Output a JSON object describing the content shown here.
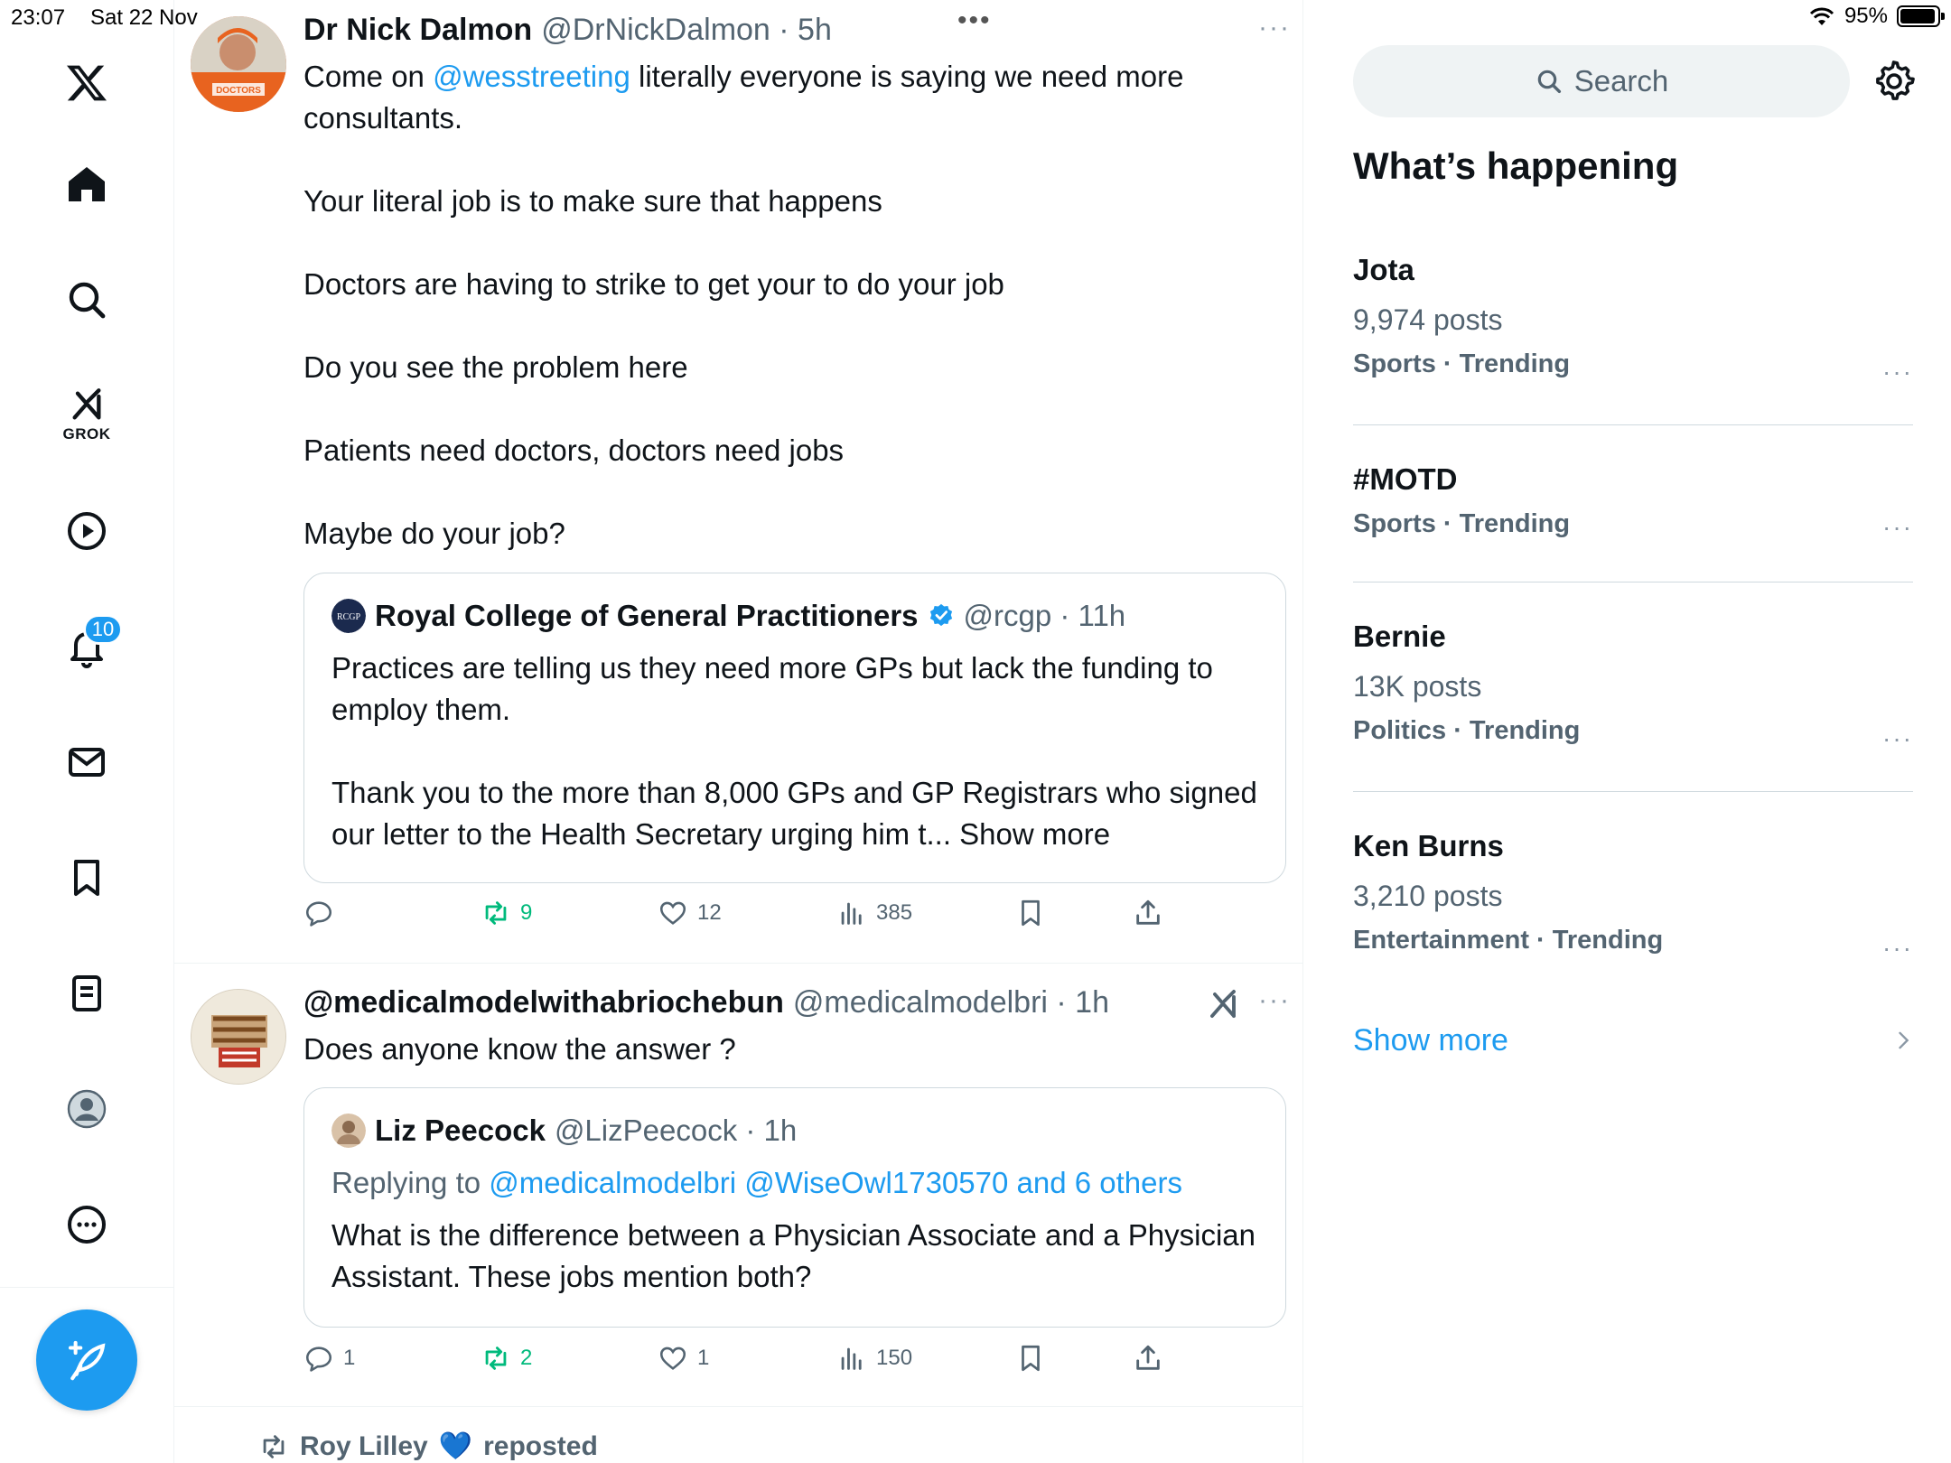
{
  "status": {
    "time": "23:07",
    "date": "Sat 22 Nov",
    "battery": "95%",
    "battery_level": 0.95
  },
  "nav": {
    "grok_label": "GROK",
    "notifications_count": "10"
  },
  "posts": [
    {
      "author": "Dr Nick Dalmon",
      "meta": "@DrNickDalmon · 5h",
      "text_prefix": "Come on ",
      "mention": "@wesstreeting",
      "text_suffix": " literally everyone is saying we need more consultants.\n\nYour literal job is to make sure that happens\n\nDoctors are having to strike to get your to do your job\n\nDo you see the problem here\n\nPatients need doctors, doctors need jobs\n\nMaybe do your job?",
      "avatar_text": "DOCTORS",
      "quote": {
        "author": "Royal College of General Practitioners",
        "avatar_text": "RCGP",
        "meta": "@rcgp · 11h",
        "text": "Practices are telling us they need more GPs but lack the funding to employ them.\n\nThank you to the more than 8,000 GPs and GP Registrars who signed our letter to the Health Secretary urging him t... Show more"
      },
      "actions": {
        "replies": "",
        "reposts": "9",
        "likes": "12",
        "views": "385"
      }
    },
    {
      "author": "@medicalmodelwithabriochebun",
      "meta": "@medicalmodelbri · 1h",
      "text": "Does anyone know the answer ?",
      "quote": {
        "author": "Liz Peecock",
        "meta": "@LizPeecock · 1h",
        "replying_to_label": "Replying to ",
        "replying_to": "@medicalmodelbri @WiseOwl1730570 and 6 others",
        "text": "What is the difference between a Physician Associate and a Physician Assistant.  These jobs mention both?"
      },
      "actions": {
        "replies": "1",
        "reposts": "2",
        "likes": "1",
        "views": "150"
      }
    }
  ],
  "reposted": {
    "name": "Roy Lilley",
    "emoji": "💙",
    "label": "reposted"
  },
  "right": {
    "search_placeholder": "Search",
    "whats_happening": "What’s happening",
    "trends": [
      {
        "title": "Jota",
        "posts": "9,974 posts",
        "category": "Sports · Trending"
      },
      {
        "title": "#MOTD",
        "posts": "",
        "category": "Sports · Trending"
      },
      {
        "title": "Bernie",
        "posts": "13K posts",
        "category": "Politics · Trending"
      },
      {
        "title": "Ken Burns",
        "posts": "3,210 posts",
        "category": "Entertainment · Trending"
      }
    ],
    "show_more": "Show more"
  },
  "colors": {
    "accent": "#1d9bf0",
    "repost": "#00ba7c",
    "muted": "#536471"
  }
}
